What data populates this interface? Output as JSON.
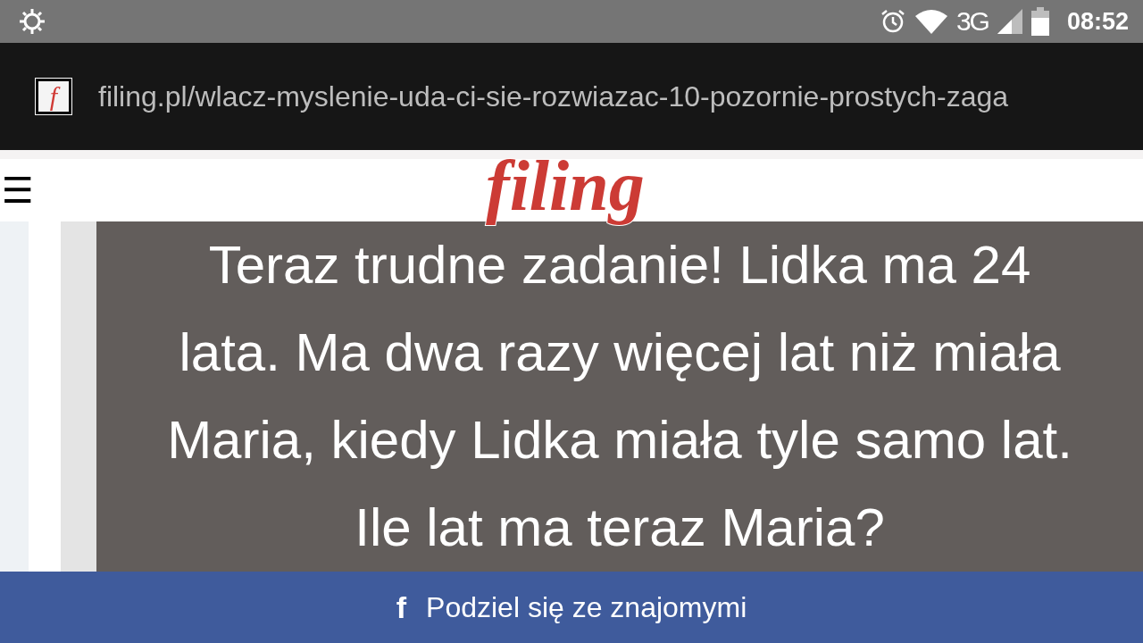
{
  "status_bar": {
    "network": "3G",
    "time": "08:52"
  },
  "address_bar": {
    "favicon_letter": "f",
    "url": "filing.pl/wlacz-myslenie-uda-ci-sie-rozwiazac-10-pozornie-prostych-zaga"
  },
  "header": {
    "menu_glyph": "☰",
    "logo": "filing"
  },
  "article": {
    "question": "Teraz trudne zadanie! Lidka ma 24 lata. Ma dwa razy więcej lat niż miała Maria, kiedy Lidka miała tyle samo lat. Ile lat ma teraz Maria?"
  },
  "share_bar": {
    "icon_letter": "f",
    "label": "Podziel się ze znajomymi"
  }
}
